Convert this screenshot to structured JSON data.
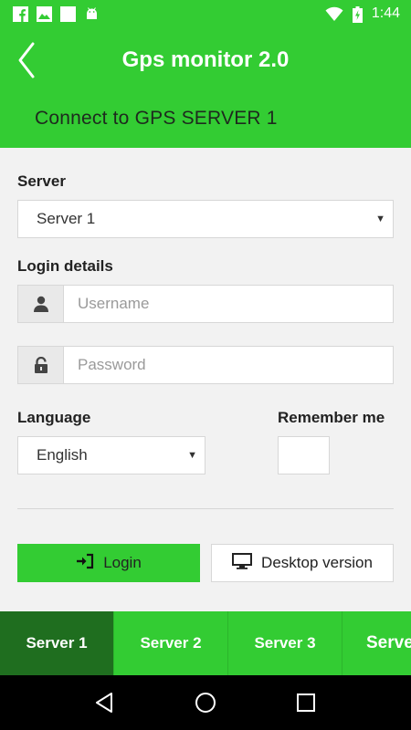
{
  "status_bar": {
    "time": "1:44",
    "icons": [
      "facebook-icon",
      "image-icon",
      "blank-square-icon",
      "android-icon",
      "wifi-icon",
      "battery-charging-icon"
    ]
  },
  "header": {
    "title": "Gps monitor 2.0",
    "subtitle": "Connect to GPS SERVER 1"
  },
  "form": {
    "server_label": "Server",
    "server_value": "Server 1",
    "login_details_label": "Login details",
    "username_placeholder": "Username",
    "password_placeholder": "Password",
    "language_label": "Language",
    "language_value": "English",
    "remember_label": "Remember me"
  },
  "buttons": {
    "login_label": "Login",
    "desktop_label": "Desktop version"
  },
  "tabs": [
    {
      "label": "Server 1",
      "active": true
    },
    {
      "label": "Server 2",
      "active": false
    },
    {
      "label": "Server 3",
      "active": false
    },
    {
      "label": "Serve",
      "active": false
    }
  ],
  "colors": {
    "accent": "#33cc33",
    "active_tab": "#1f6e1f",
    "background": "#f2f2f2"
  }
}
